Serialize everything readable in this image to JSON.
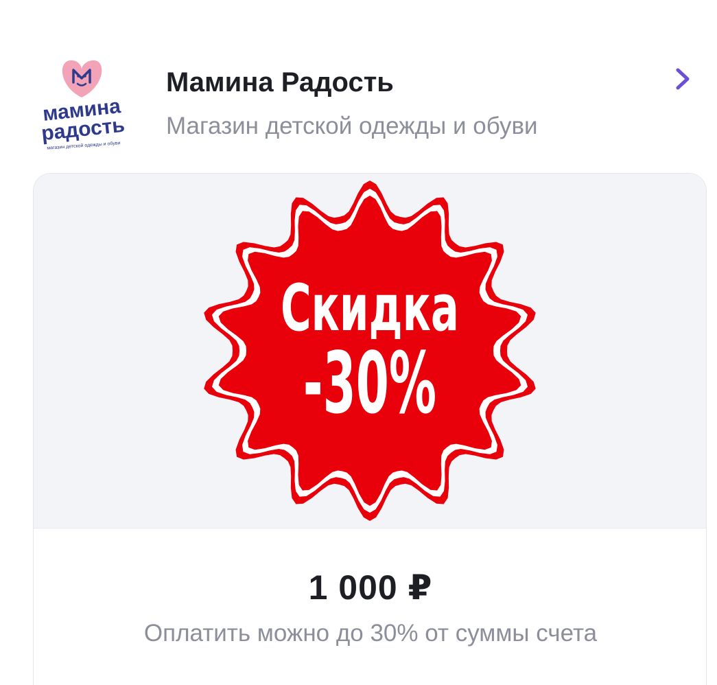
{
  "shop": {
    "name": "Мамина Радость",
    "description": "Магазин детской одежды и обуви",
    "logo": {
      "line1": "мамина",
      "line2": "радость",
      "tagline": "магазин детской одежды и обуви"
    }
  },
  "promo": {
    "badge_line1": "Скидка",
    "badge_line2": "-30%",
    "badge_color": "#e8000b"
  },
  "offer": {
    "price": "1 000 ₽",
    "note": "Оплатить можно до 30% от суммы счета"
  },
  "icons": {
    "open": "chevron-right-icon"
  },
  "colors": {
    "accent": "#6b4fd8",
    "logo_pink": "#f2a3b7",
    "logo_blue": "#2e3a8c"
  }
}
